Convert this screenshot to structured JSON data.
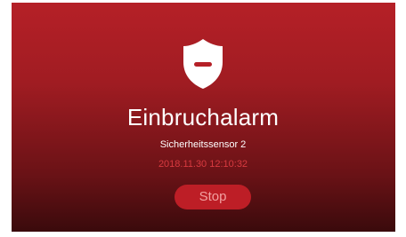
{
  "alarm": {
    "icon": "shield-icon",
    "title": "Einbruchalarm",
    "sensor_name": "Sicherheitssensor 2",
    "timestamp": "2018.11.30 12:10:32",
    "stop_label": "Stop"
  },
  "colors": {
    "background_top": "#b52027",
    "background_bottom": "#3a0a0c",
    "timestamp": "#d83a40",
    "button": "#bd1e26",
    "button_text": "#f2a0a0"
  }
}
